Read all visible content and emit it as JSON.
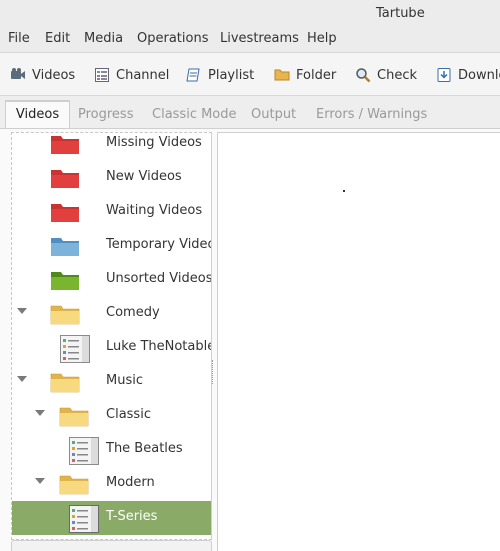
{
  "window": {
    "title": "Tartube"
  },
  "menu": [
    "File",
    "Edit",
    "Media",
    "Operations",
    "Livestreams",
    "Help"
  ],
  "toolbar": [
    {
      "label": "Videos",
      "icon": "videos-icon"
    },
    {
      "label": "Channel",
      "icon": "channel-icon"
    },
    {
      "label": "Playlist",
      "icon": "playlist-icon"
    },
    {
      "label": "Folder",
      "icon": "folder-icon"
    },
    {
      "label": "Check",
      "icon": "check-icon"
    },
    {
      "label": "Downlo",
      "icon": "download-icon"
    }
  ],
  "tabs": [
    "Videos",
    "Progress",
    "Classic Mode",
    "Output",
    "Errors / Warnings"
  ],
  "active_tab": "Videos",
  "tree": [
    {
      "label": "Missing Videos",
      "icon": "red-folder-icon"
    },
    {
      "label": "New Videos",
      "icon": "red-folder-icon"
    },
    {
      "label": "Waiting Videos",
      "icon": "red-folder-icon"
    },
    {
      "label": "Temporary Video",
      "icon": "blue-folder-icon"
    },
    {
      "label": "Unsorted Videos",
      "icon": "green-folder-icon"
    },
    {
      "label": "Comedy",
      "icon": "yellow-folder-icon",
      "expanded": true
    },
    {
      "label": "Luke TheNotable",
      "icon": "channel-icon"
    },
    {
      "label": "Music",
      "icon": "yellow-folder-icon",
      "expanded": true
    },
    {
      "label": "Classic",
      "icon": "yellow-folder-icon",
      "expanded": true
    },
    {
      "label": "The Beatles",
      "icon": "channel-icon"
    },
    {
      "label": "Modern",
      "icon": "yellow-folder-icon",
      "expanded": true
    },
    {
      "label": "T-Series",
      "icon": "channel-icon",
      "selected": true
    }
  ],
  "colors": {
    "selection": "#8aab68",
    "red_folder": "#e2403f",
    "blue_folder": "#7cb3db",
    "green_folder": "#79b52e",
    "yellow_folder": "#f5cf6b"
  }
}
